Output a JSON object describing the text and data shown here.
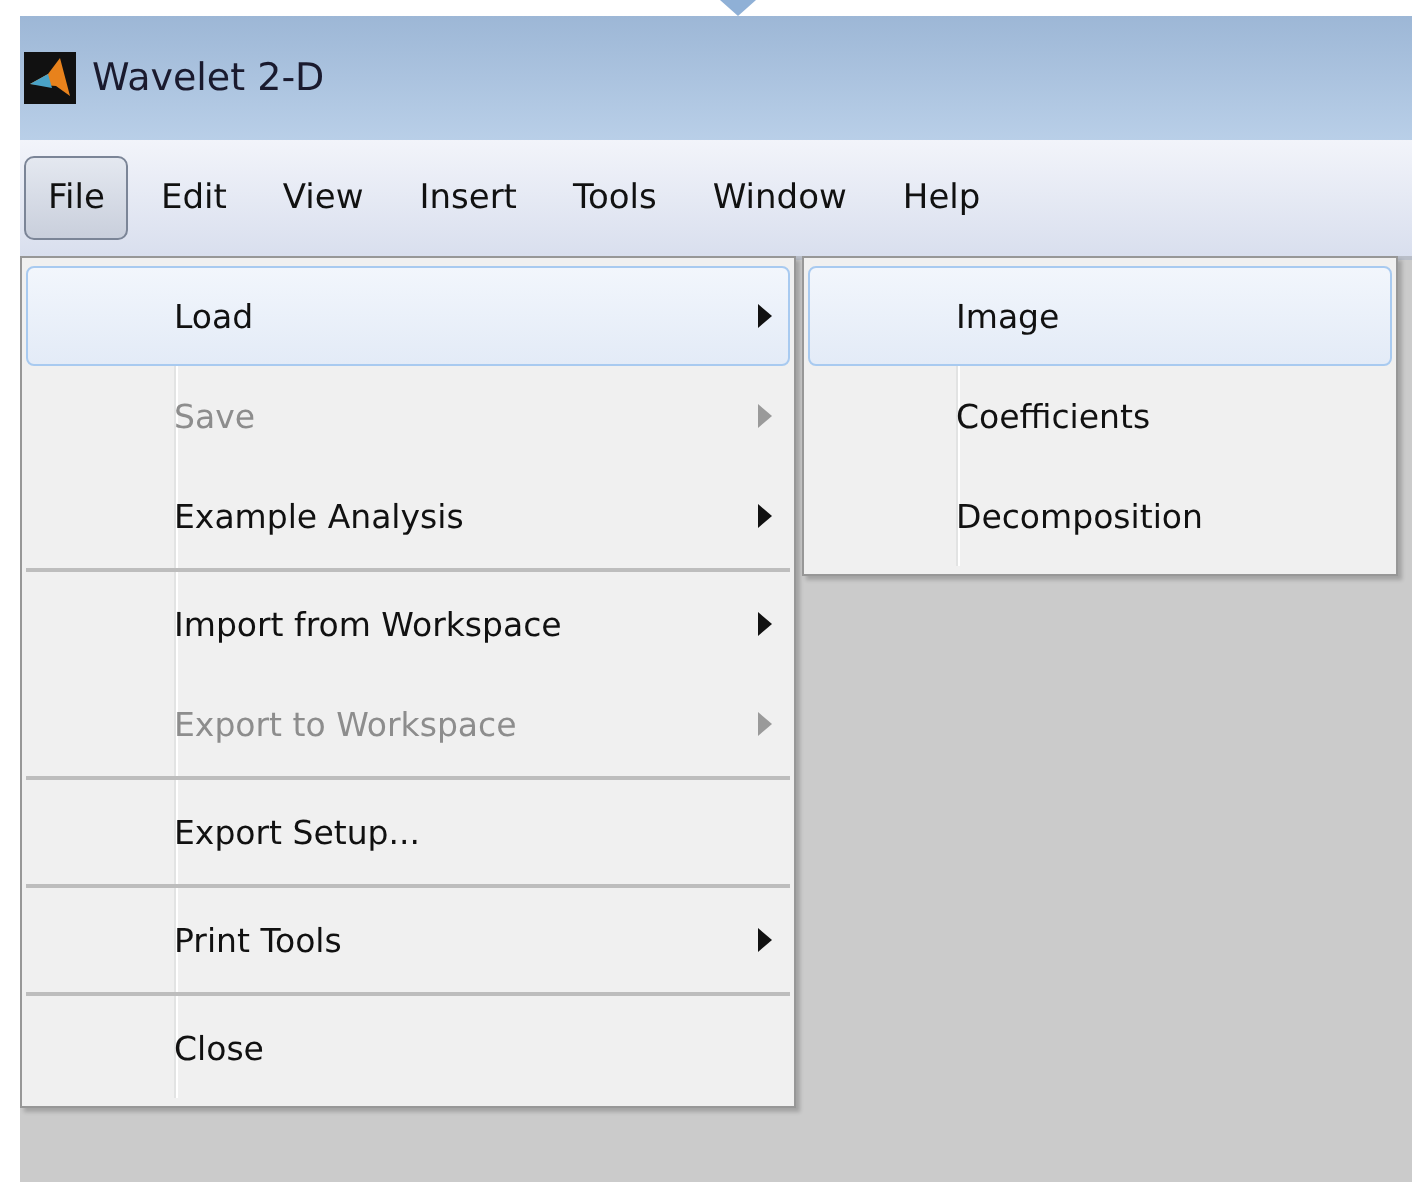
{
  "window": {
    "title": "Wavelet 2-D"
  },
  "menu_bar": [
    {
      "label": "File",
      "selected": true
    },
    {
      "label": "Edit",
      "selected": false
    },
    {
      "label": "View",
      "selected": false
    },
    {
      "label": "Insert",
      "selected": false
    },
    {
      "label": "Tools",
      "selected": false
    },
    {
      "label": "Window",
      "selected": false
    },
    {
      "label": "Help",
      "selected": false
    }
  ],
  "file_menu": [
    {
      "kind": "item",
      "label": "Load",
      "selected": true,
      "disabled": false,
      "submenu": true
    },
    {
      "kind": "item",
      "label": "Save",
      "selected": false,
      "disabled": true,
      "submenu": true
    },
    {
      "kind": "item",
      "label": "Example Analysis",
      "selected": false,
      "disabled": false,
      "submenu": true
    },
    {
      "kind": "separator"
    },
    {
      "kind": "item",
      "label": "Import from Workspace",
      "selected": false,
      "disabled": false,
      "submenu": true
    },
    {
      "kind": "item",
      "label": "Export to Workspace",
      "selected": false,
      "disabled": true,
      "submenu": true
    },
    {
      "kind": "separator"
    },
    {
      "kind": "item",
      "label": "Export Setup...",
      "selected": false,
      "disabled": false,
      "submenu": false
    },
    {
      "kind": "separator"
    },
    {
      "kind": "item",
      "label": "Print Tools",
      "selected": false,
      "disabled": false,
      "submenu": true
    },
    {
      "kind": "separator"
    },
    {
      "kind": "item",
      "label": "Close",
      "selected": false,
      "disabled": false,
      "submenu": false
    }
  ],
  "load_submenu": [
    {
      "label": "Image",
      "selected": true
    },
    {
      "label": "Coefficients",
      "selected": false
    },
    {
      "label": "Decomposition",
      "selected": false
    }
  ]
}
